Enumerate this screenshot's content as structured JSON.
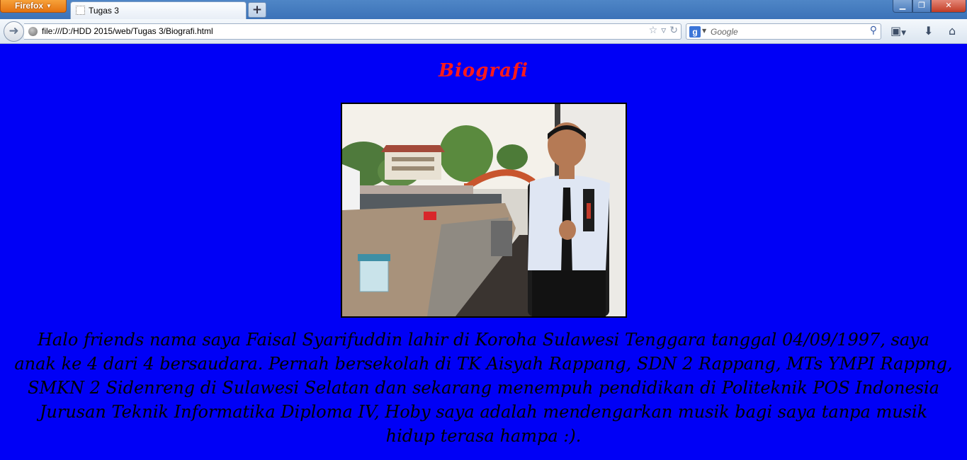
{
  "browser": {
    "app_menu_label": "Firefox",
    "tab": {
      "title": "Tugas 3"
    },
    "new_tab_label": "+",
    "url": "file:///D:/HDD 2015/web/Tugas 3/Biografi.html",
    "search": {
      "placeholder": "Google",
      "engine_icon": "g"
    }
  },
  "page": {
    "title": "Biografi",
    "bio": "Halo friends nama saya Faisal Syarifuddin lahir di Koroha Sulawesi Tenggara tanggal 04/09/1997, saya anak ke 4 dari 4 bersaudara. Pernah bersekolah di TK Aisyah Rappang, SDN 2 Rappang, MTs YMPI Rappng, SMKN 2 Sidenreng di Sulawesi Selatan dan sekarang menempuh pendidikan di Politeknik POS Indonesia Jurusan Teknik Informatika Diploma IV, Hoby saya adalah mendengarkan musik bagi saya tanpa musik hidup terasa hampa :)."
  },
  "colors": {
    "page_background": "#0000f6",
    "title": "#ff1a1a",
    "bio_text": "#000000"
  }
}
